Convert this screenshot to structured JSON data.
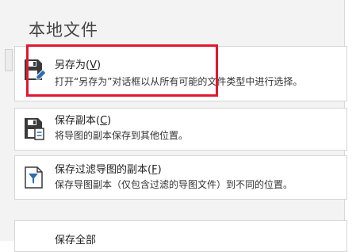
{
  "section_title": "本地文件",
  "items": [
    {
      "label_prefix": "另存为(",
      "label_key": "V",
      "label_suffix": ")",
      "description": "打开“另存为”对话框以从所有可能的文件类型中进行选择。",
      "icon": "save-as-icon"
    },
    {
      "label_prefix": "保存副本(",
      "label_key": "C",
      "label_suffix": ")",
      "description": "将导图的副本保存到其他位置。",
      "icon": "save-copy-icon"
    },
    {
      "label_prefix": "保存过滤导图的副本(",
      "label_key": "F",
      "label_suffix": ")",
      "description": "保存导图副本（仅包含过滤的导图文件）到不同的位置。",
      "icon": "save-filtered-copy-icon"
    },
    {
      "label_prefix": "保存全部",
      "label_key": "",
      "label_suffix": "",
      "description": "",
      "icon": "save-all-icon"
    }
  ],
  "colors": {
    "highlight": "#e0182f",
    "panel_bg": "#f3f3f3",
    "icon_dark": "#3a3a3a",
    "icon_accent": "#2b6cb3"
  }
}
